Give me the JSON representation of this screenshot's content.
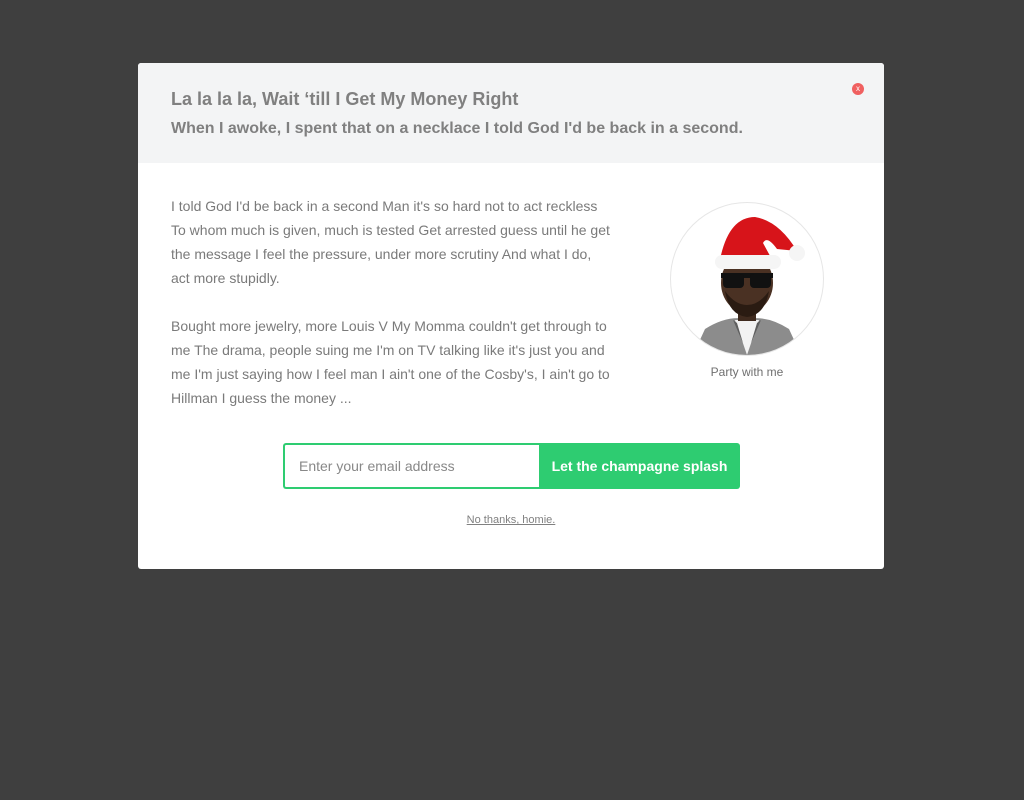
{
  "modal": {
    "title": "La la la la, Wait ‘till I Get My Money Right",
    "subtitle": "When I awoke, I spent that on a necklace I told God I'd be back in a second.",
    "close_label": "x",
    "paragraphs": [
      "I told God I'd be back in a second Man it's so hard not to act reckless To whom much is given, much is tested Get arrested guess until he get the message I feel the pressure, under more scrutiny And what I do, act more stupidly.",
      "Bought more jewelry, more Louis V My Momma couldn't get through to me The drama, people suing me I'm on TV talking like it's just you and me I'm just saying how I feel man I ain't one of the Cosby's, I ain't go to Hillman I guess the money ..."
    ],
    "avatar_caption": "Party with me",
    "email_placeholder": "Enter your email address",
    "email_value": "",
    "submit_label": "Let the champagne splash",
    "decline_label": "No thanks, homie."
  },
  "colors": {
    "overlay": "#3f3f3f",
    "header_bg": "#f3f4f5",
    "accent": "#2ecc71",
    "close": "#f06060",
    "text": "#7a7a7a"
  },
  "icons": {
    "close": "close-icon",
    "avatar": "santa-hat-portrait"
  }
}
